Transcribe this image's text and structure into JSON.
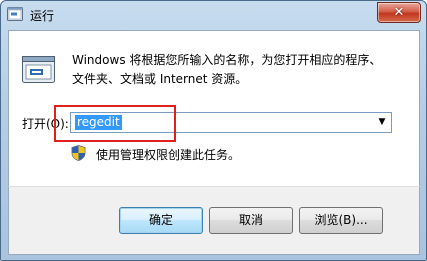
{
  "window": {
    "title": "运行"
  },
  "description": {
    "line1": "Windows 将根据您所输入的名称，为您打开相应的程序、",
    "line2": "文件夹、文档或 Internet 资源。"
  },
  "open": {
    "label": "打开(O):",
    "value": "regedit"
  },
  "admin_note": "使用管理权限创建此任务。",
  "buttons": {
    "ok": "确定",
    "cancel": "取消",
    "browse": "浏览(B)..."
  },
  "icons": {
    "app": "run-app-icon",
    "dialog": "run-dialog-icon",
    "shield": "uac-shield-icon",
    "dropdown": "dropdown-arrow-icon",
    "close": "close-icon"
  },
  "colors": {
    "highlight": "#e0201a",
    "selection": "#3399ff",
    "close": "#c2361f"
  }
}
